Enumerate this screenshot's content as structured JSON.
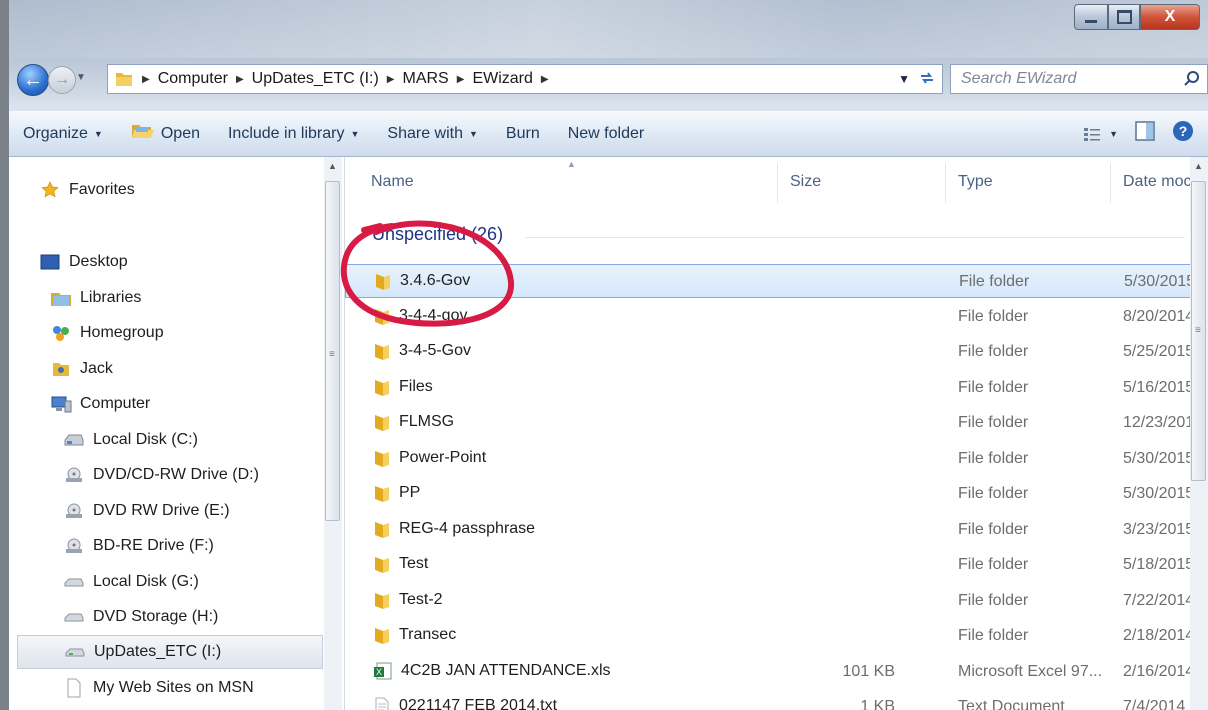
{
  "window": {
    "caption": {
      "minimize": "",
      "maximize": "",
      "close": "X"
    }
  },
  "address": {
    "crumbs": [
      "Computer",
      "UpDates_ETC (I:)",
      "MARS",
      "EWizard"
    ]
  },
  "search": {
    "placeholder": "Search EWizard"
  },
  "commands": {
    "organize": "Organize",
    "open": "Open",
    "include": "Include in library",
    "share": "Share with",
    "burn": "Burn",
    "new_folder": "New folder"
  },
  "nav": {
    "favorites": "Favorites",
    "desktop": "Desktop",
    "libraries": "Libraries",
    "homegroup": "Homegroup",
    "jack": "Jack",
    "computer": "Computer",
    "drives": [
      "Local Disk (C:)",
      "DVD/CD-RW Drive (D:)",
      "DVD RW Drive (E:)",
      "BD-RE Drive (F:)",
      "Local Disk (G:)",
      "DVD Storage (H:)",
      "UpDates_ETC (I:)",
      "My Web Sites on MSN"
    ]
  },
  "columns": {
    "name": "Name",
    "size": "Size",
    "type": "Type",
    "date": "Date moc"
  },
  "group": {
    "label": "Unspecified (26)"
  },
  "files": [
    {
      "name": "3.4.6-Gov",
      "size": "",
      "type": "File folder",
      "date": "5/30/2015"
    },
    {
      "name": "3-4-4-gov",
      "size": "",
      "type": "File folder",
      "date": "8/20/2014"
    },
    {
      "name": "3-4-5-Gov",
      "size": "",
      "type": "File folder",
      "date": "5/25/2015"
    },
    {
      "name": "Files",
      "size": "",
      "type": "File folder",
      "date": "5/16/2015"
    },
    {
      "name": "FLMSG",
      "size": "",
      "type": "File folder",
      "date": "12/23/201"
    },
    {
      "name": "Power-Point",
      "size": "",
      "type": "File folder",
      "date": "5/30/2015"
    },
    {
      "name": "PP",
      "size": "",
      "type": "File folder",
      "date": "5/30/2015"
    },
    {
      "name": "REG-4 passphrase",
      "size": "",
      "type": "File folder",
      "date": "3/23/2015"
    },
    {
      "name": "Test",
      "size": "",
      "type": "File folder",
      "date": "5/18/2015"
    },
    {
      "name": "Test-2",
      "size": "",
      "type": "File folder",
      "date": "7/22/2014"
    },
    {
      "name": "Transec",
      "size": "",
      "type": "File folder",
      "date": "2/18/2014"
    },
    {
      "name": "4C2B JAN ATTENDANCE.xls",
      "size": "101 KB",
      "type": "Microsoft Excel 97...",
      "date": "2/16/2014"
    },
    {
      "name": "0221147 FEB 2014.txt",
      "size": "1 KB",
      "type": "Text Document",
      "date": "7/4/2014"
    }
  ],
  "colors": {
    "annotation_circle": "#d81b45",
    "accent": "#1e395b",
    "selection": "#cde6fb"
  }
}
